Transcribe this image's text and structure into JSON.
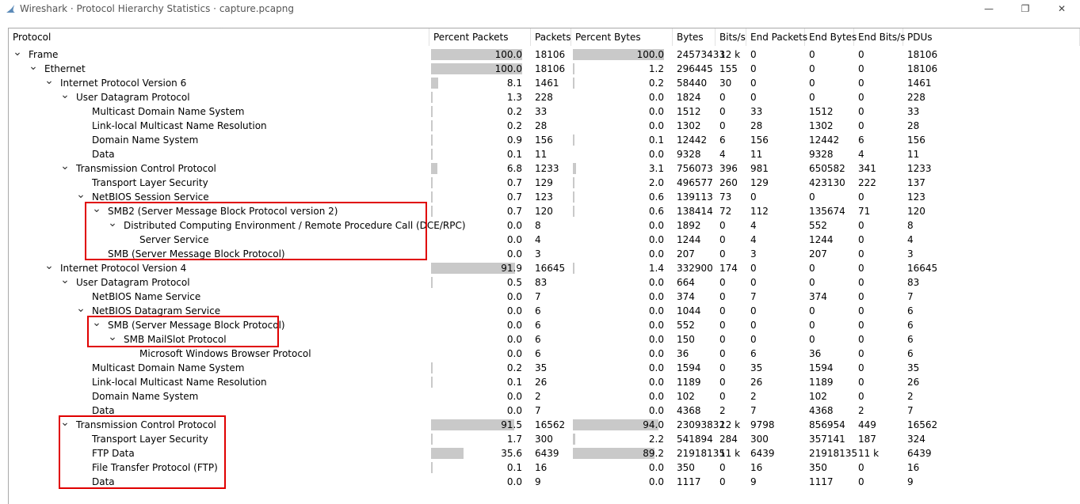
{
  "window": {
    "title": "Wireshark · Protocol Hierarchy Statistics · capture.pcapng",
    "minimize_glyph": "—",
    "maximize_glyph": "❐",
    "close_glyph": "✕",
    "icon": "wireshark-fin-icon"
  },
  "columns": [
    "Protocol",
    "Percent Packets",
    "Packets",
    "Percent Bytes",
    "Bytes",
    "Bits/s",
    "End Packets",
    "End Bytes",
    "End Bits/s",
    "PDUs"
  ],
  "rows": [
    {
      "name": "Frame",
      "depth": 0,
      "exp": true,
      "pp": "100.0",
      "pkts": "18106",
      "pb": "100.0",
      "bytes": "24573433",
      "bits": "12 k",
      "ep": "0",
      "eb": "0",
      "ebits": "0",
      "pdus": "18106"
    },
    {
      "name": "Ethernet",
      "depth": 1,
      "exp": true,
      "pp": "100.0",
      "pkts": "18106",
      "pb": "1.2",
      "bytes": "296445",
      "bits": "155",
      "ep": "0",
      "eb": "0",
      "ebits": "0",
      "pdus": "18106"
    },
    {
      "name": "Internet Protocol Version 6",
      "depth": 2,
      "exp": true,
      "pp": "8.1",
      "pkts": "1461",
      "pb": "0.2",
      "bytes": "58440",
      "bits": "30",
      "ep": "0",
      "eb": "0",
      "ebits": "0",
      "pdus": "1461"
    },
    {
      "name": "User Datagram Protocol",
      "depth": 3,
      "exp": true,
      "pp": "1.3",
      "pkts": "228",
      "pb": "0.0",
      "bytes": "1824",
      "bits": "0",
      "ep": "0",
      "eb": "0",
      "ebits": "0",
      "pdus": "228"
    },
    {
      "name": "Multicast Domain Name System",
      "depth": 4,
      "exp": false,
      "pp": "0.2",
      "pkts": "33",
      "pb": "0.0",
      "bytes": "1512",
      "bits": "0",
      "ep": "33",
      "eb": "1512",
      "ebits": "0",
      "pdus": "33"
    },
    {
      "name": "Link-local Multicast Name Resolution",
      "depth": 4,
      "exp": false,
      "pp": "0.2",
      "pkts": "28",
      "pb": "0.0",
      "bytes": "1302",
      "bits": "0",
      "ep": "28",
      "eb": "1302",
      "ebits": "0",
      "pdus": "28"
    },
    {
      "name": "Domain Name System",
      "depth": 4,
      "exp": false,
      "pp": "0.9",
      "pkts": "156",
      "pb": "0.1",
      "bytes": "12442",
      "bits": "6",
      "ep": "156",
      "eb": "12442",
      "ebits": "6",
      "pdus": "156"
    },
    {
      "name": "Data",
      "depth": 4,
      "exp": false,
      "pp": "0.1",
      "pkts": "11",
      "pb": "0.0",
      "bytes": "9328",
      "bits": "4",
      "ep": "11",
      "eb": "9328",
      "ebits": "4",
      "pdus": "11"
    },
    {
      "name": "Transmission Control Protocol",
      "depth": 3,
      "exp": true,
      "pp": "6.8",
      "pkts": "1233",
      "pb": "3.1",
      "bytes": "756073",
      "bits": "396",
      "ep": "981",
      "eb": "650582",
      "ebits": "341",
      "pdus": "1233"
    },
    {
      "name": "Transport Layer Security",
      "depth": 4,
      "exp": false,
      "pp": "0.7",
      "pkts": "129",
      "pb": "2.0",
      "bytes": "496577",
      "bits": "260",
      "ep": "129",
      "eb": "423130",
      "ebits": "222",
      "pdus": "137"
    },
    {
      "name": "NetBIOS Session Service",
      "depth": 4,
      "exp": true,
      "pp": "0.7",
      "pkts": "123",
      "pb": "0.6",
      "bytes": "139113",
      "bits": "73",
      "ep": "0",
      "eb": "0",
      "ebits": "0",
      "pdus": "123"
    },
    {
      "name": "SMB2 (Server Message Block Protocol version 2)",
      "depth": 5,
      "exp": true,
      "pp": "0.7",
      "pkts": "120",
      "pb": "0.6",
      "bytes": "138414",
      "bits": "72",
      "ep": "112",
      "eb": "135674",
      "ebits": "71",
      "pdus": "120"
    },
    {
      "name": "Distributed Computing Environment / Remote Procedure Call (DCE/RPC)",
      "depth": 6,
      "exp": true,
      "pp": "0.0",
      "pkts": "8",
      "pb": "0.0",
      "bytes": "1892",
      "bits": "0",
      "ep": "4",
      "eb": "552",
      "ebits": "0",
      "pdus": "8"
    },
    {
      "name": "Server Service",
      "depth": 7,
      "exp": false,
      "pp": "0.0",
      "pkts": "4",
      "pb": "0.0",
      "bytes": "1244",
      "bits": "0",
      "ep": "4",
      "eb": "1244",
      "ebits": "0",
      "pdus": "4"
    },
    {
      "name": "SMB (Server Message Block Protocol)",
      "depth": 5,
      "exp": false,
      "pp": "0.0",
      "pkts": "3",
      "pb": "0.0",
      "bytes": "207",
      "bits": "0",
      "ep": "3",
      "eb": "207",
      "ebits": "0",
      "pdus": "3"
    },
    {
      "name": "Internet Protocol Version 4",
      "depth": 2,
      "exp": true,
      "pp": "91.9",
      "pkts": "16645",
      "pb": "1.4",
      "bytes": "332900",
      "bits": "174",
      "ep": "0",
      "eb": "0",
      "ebits": "0",
      "pdus": "16645"
    },
    {
      "name": "User Datagram Protocol",
      "depth": 3,
      "exp": true,
      "pp": "0.5",
      "pkts": "83",
      "pb": "0.0",
      "bytes": "664",
      "bits": "0",
      "ep": "0",
      "eb": "0",
      "ebits": "0",
      "pdus": "83"
    },
    {
      "name": "NetBIOS Name Service",
      "depth": 4,
      "exp": false,
      "pp": "0.0",
      "pkts": "7",
      "pb": "0.0",
      "bytes": "374",
      "bits": "0",
      "ep": "7",
      "eb": "374",
      "ebits": "0",
      "pdus": "7"
    },
    {
      "name": "NetBIOS Datagram Service",
      "depth": 4,
      "exp": true,
      "pp": "0.0",
      "pkts": "6",
      "pb": "0.0",
      "bytes": "1044",
      "bits": "0",
      "ep": "0",
      "eb": "0",
      "ebits": "0",
      "pdus": "6"
    },
    {
      "name": "SMB (Server Message Block Protocol)",
      "depth": 5,
      "exp": true,
      "pp": "0.0",
      "pkts": "6",
      "pb": "0.0",
      "bytes": "552",
      "bits": "0",
      "ep": "0",
      "eb": "0",
      "ebits": "0",
      "pdus": "6"
    },
    {
      "name": "SMB MailSlot Protocol",
      "depth": 6,
      "exp": true,
      "pp": "0.0",
      "pkts": "6",
      "pb": "0.0",
      "bytes": "150",
      "bits": "0",
      "ep": "0",
      "eb": "0",
      "ebits": "0",
      "pdus": "6"
    },
    {
      "name": "Microsoft Windows Browser Protocol",
      "depth": 7,
      "exp": false,
      "pp": "0.0",
      "pkts": "6",
      "pb": "0.0",
      "bytes": "36",
      "bits": "0",
      "ep": "6",
      "eb": "36",
      "ebits": "0",
      "pdus": "6"
    },
    {
      "name": "Multicast Domain Name System",
      "depth": 4,
      "exp": false,
      "pp": "0.2",
      "pkts": "35",
      "pb": "0.0",
      "bytes": "1594",
      "bits": "0",
      "ep": "35",
      "eb": "1594",
      "ebits": "0",
      "pdus": "35"
    },
    {
      "name": "Link-local Multicast Name Resolution",
      "depth": 4,
      "exp": false,
      "pp": "0.1",
      "pkts": "26",
      "pb": "0.0",
      "bytes": "1189",
      "bits": "0",
      "ep": "26",
      "eb": "1189",
      "ebits": "0",
      "pdus": "26"
    },
    {
      "name": "Domain Name System",
      "depth": 4,
      "exp": false,
      "pp": "0.0",
      "pkts": "2",
      "pb": "0.0",
      "bytes": "102",
      "bits": "0",
      "ep": "2",
      "eb": "102",
      "ebits": "0",
      "pdus": "2"
    },
    {
      "name": "Data",
      "depth": 4,
      "exp": false,
      "pp": "0.0",
      "pkts": "7",
      "pb": "0.0",
      "bytes": "4368",
      "bits": "2",
      "ep": "7",
      "eb": "4368",
      "ebits": "2",
      "pdus": "7"
    },
    {
      "name": "Transmission Control Protocol",
      "depth": 3,
      "exp": true,
      "pp": "91.5",
      "pkts": "16562",
      "pb": "94.0",
      "bytes": "23093832",
      "bits": "12 k",
      "ep": "9798",
      "eb": "856954",
      "ebits": "449",
      "pdus": "16562"
    },
    {
      "name": "Transport Layer Security",
      "depth": 4,
      "exp": false,
      "pp": "1.7",
      "pkts": "300",
      "pb": "2.2",
      "bytes": "541894",
      "bits": "284",
      "ep": "300",
      "eb": "357141",
      "ebits": "187",
      "pdus": "324"
    },
    {
      "name": "FTP Data",
      "depth": 4,
      "exp": false,
      "pp": "35.6",
      "pkts": "6439",
      "pb": "89.2",
      "bytes": "21918135",
      "bits": "11 k",
      "ep": "6439",
      "eb": "21918135",
      "ebits": "11 k",
      "pdus": "6439"
    },
    {
      "name": "File Transfer Protocol (FTP)",
      "depth": 4,
      "exp": false,
      "pp": "0.1",
      "pkts": "16",
      "pb": "0.0",
      "bytes": "350",
      "bits": "0",
      "ep": "16",
      "eb": "350",
      "ebits": "0",
      "pdus": "16"
    },
    {
      "name": "Data",
      "depth": 4,
      "exp": false,
      "pp": "0.0",
      "pkts": "9",
      "pb": "0.0",
      "bytes": "1117",
      "bits": "0",
      "ep": "9",
      "eb": "1117",
      "ebits": "0",
      "pdus": "9"
    }
  ],
  "highlight_color": "#e00000",
  "bar_color": "#c9c9c9"
}
